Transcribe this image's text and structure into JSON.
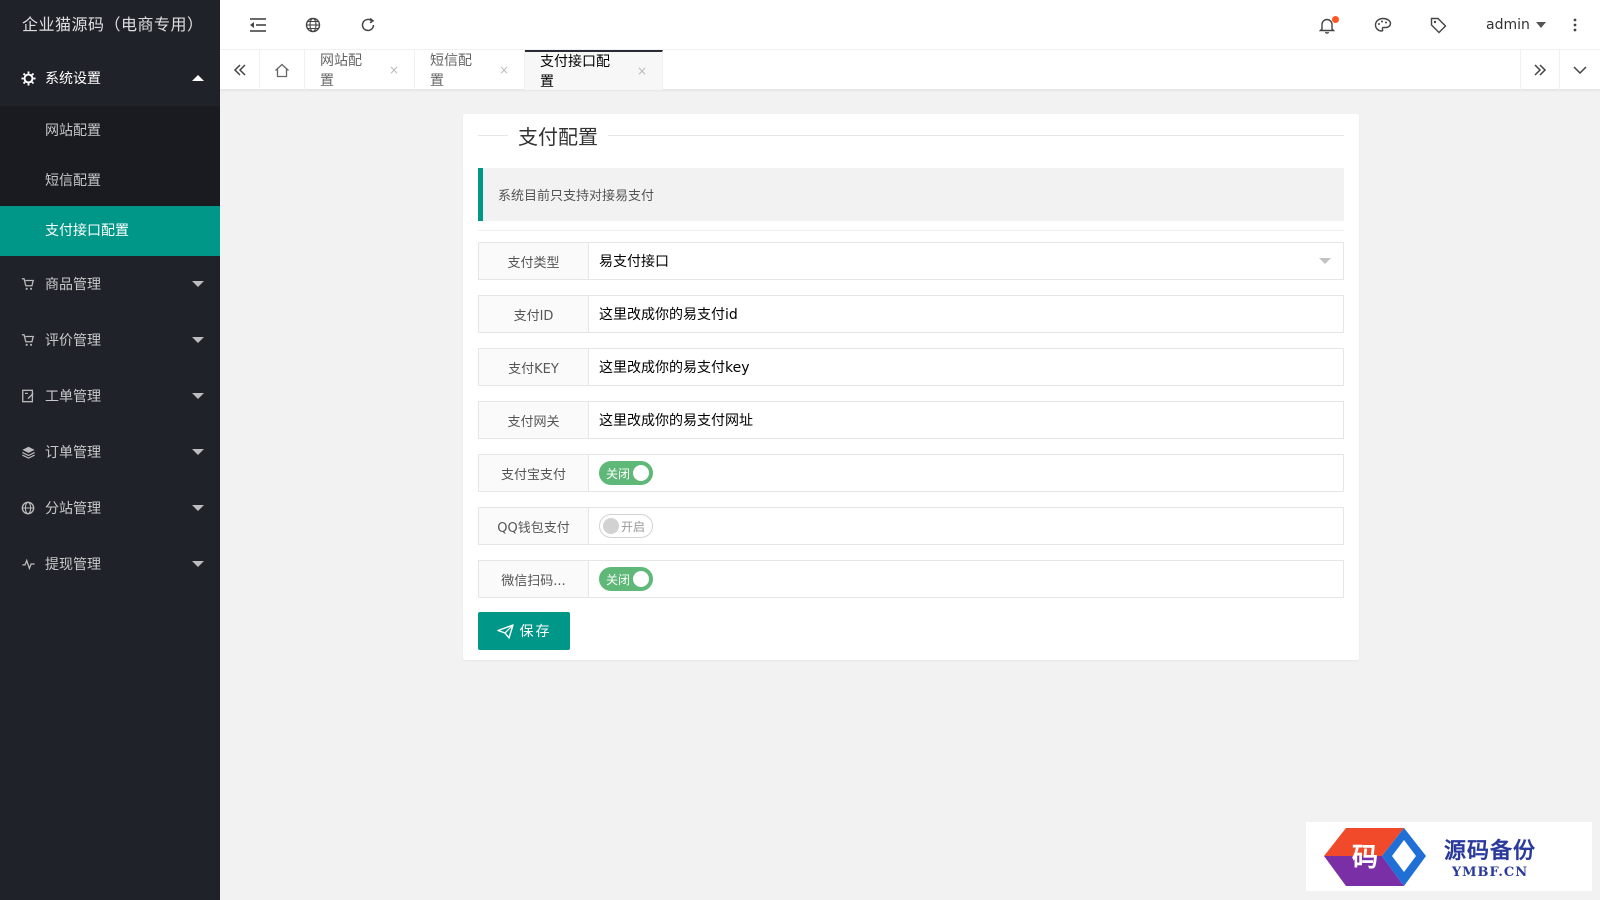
{
  "app": {
    "title": "企业猫源码（电商专用）"
  },
  "sidebar": {
    "groups": [
      {
        "label": "系统设置",
        "icon": "gear-icon",
        "expanded": true,
        "children": [
          "网站配置",
          "短信配置",
          "支付接口配置"
        ],
        "active_child": "支付接口配置"
      },
      {
        "label": "商品管理",
        "icon": "cart-icon"
      },
      {
        "label": "评价管理",
        "icon": "cart-icon"
      },
      {
        "label": "工单管理",
        "icon": "ticket-icon"
      },
      {
        "label": "订单管理",
        "icon": "layers-icon"
      },
      {
        "label": "分站管理",
        "icon": "globe-icon"
      },
      {
        "label": "提现管理",
        "icon": "pulse-icon"
      }
    ]
  },
  "header": {
    "user": "admin",
    "icons": [
      "menu-toggle-icon",
      "globe-icon",
      "refresh-icon",
      "bell-icon",
      "palette-icon",
      "tag-icon",
      "more-vertical-icon"
    ],
    "notification_dot_color": "#ff5722"
  },
  "tabs": {
    "items": [
      {
        "label": "网站配置",
        "closable": true
      },
      {
        "label": "短信配置",
        "closable": true
      },
      {
        "label": "支付接口配置",
        "closable": true,
        "active": true
      }
    ],
    "close_glyph": "×"
  },
  "form": {
    "title": "支付配置",
    "notice": "系统目前只支持对接易支付",
    "fields": [
      {
        "label": "支付类型",
        "type": "select",
        "value": "易支付接口"
      },
      {
        "label": "支付ID",
        "type": "text",
        "value": "这里改成你的易支付id"
      },
      {
        "label": "支付KEY",
        "type": "text",
        "value": "这里改成你的易支付key"
      },
      {
        "label": "支付网关",
        "type": "text",
        "value": "这里改成你的易支付网址"
      },
      {
        "label": "支付宝支付",
        "type": "switch",
        "on": true,
        "text": "关闭"
      },
      {
        "label": "QQ钱包支付",
        "type": "switch",
        "on": false,
        "text": "开启"
      },
      {
        "label": "微信扫码...",
        "type": "switch",
        "on": true,
        "text": "关闭"
      }
    ],
    "save_label": "保存"
  },
  "watermark": {
    "cn": "源码备份",
    "en": "YMBF.CN",
    "glyph": "码"
  },
  "colors": {
    "accent": "#009688",
    "sidebar_bg": "#20222a",
    "switch_on": "#5fb878"
  }
}
